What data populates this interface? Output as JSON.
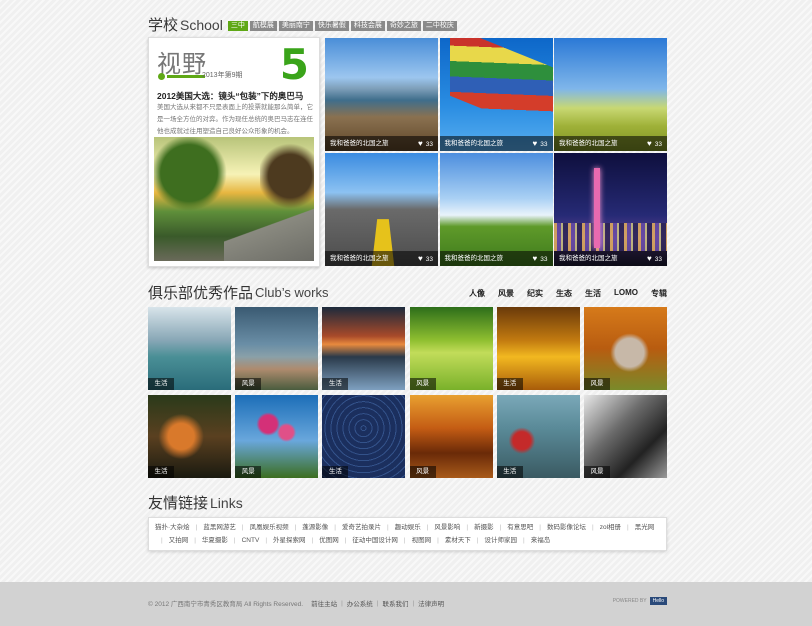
{
  "school": {
    "title_cn": "学校",
    "title_en": "School",
    "tabs": [
      "三中",
      "航模展",
      "美丽南宁",
      "快乐暑假",
      "科技会展",
      "奇妙之旅",
      "二中校庆"
    ],
    "active_tab": 0
  },
  "magazine": {
    "logo": "视野",
    "issue_number": "5",
    "date": "2013年第9期",
    "headline": "2012美国大选：镜头“包装”下的奥巴马",
    "summary": "美国大选从来都不只是表面上的投票就能那么简单，它是一场全方位的对弈。作为现任总统的奥巴马志在连任他也成就过往用塑造自己良好公众形象的机会。"
  },
  "photo_grid": [
    {
      "caption": "我和爸爸的北国之旅",
      "likes": "33"
    },
    {
      "caption": "我和爸爸的北国之旅",
      "likes": "33"
    },
    {
      "caption": "我和爸爸的北国之旅",
      "likes": "33"
    },
    {
      "caption": "我和爸爸的北国之旅",
      "likes": "33"
    },
    {
      "caption": "我和爸爸的北国之旅",
      "likes": "33"
    },
    {
      "caption": "我和爸爸的北国之旅",
      "likes": "33"
    }
  ],
  "club": {
    "title_cn": "俱乐部优秀作品",
    "title_en": "Club’s works",
    "nav": [
      "人像",
      "风景",
      "纪实",
      "生态",
      "生活",
      "LOMO",
      "专辑"
    ],
    "tiles": [
      "生活",
      "风景",
      "生活",
      "风景",
      "生活",
      "风景",
      "生活",
      "风景",
      "生活",
      "风景",
      "生活",
      "风景"
    ]
  },
  "links": {
    "title_cn": "友情链接",
    "title_en": "Links",
    "items": [
      "猫扑·大杂烩",
      "蓝黑网游艺",
      "凤凰娱乐视频",
      "蓬源影像",
      "爱奇艺拍录片",
      "趣动娱乐",
      "风景影响",
      "新摄影",
      "有意思吧",
      "数码影像论坛",
      "zol相册",
      "黑光网",
      "又拍网",
      "华夏摄影",
      "CNTV",
      "外星探索网",
      "优图网",
      "征动中国设计网",
      "视图网",
      "素材天下",
      "设计师家园",
      "来福岛"
    ]
  },
  "footer": {
    "copyright": "© 2012 广西南宁市青秀区教育局  All Rights Reserved.",
    "links": [
      "前往主站",
      "办公系统",
      "联系我们",
      "法律声明"
    ],
    "powered_text": "POWERED BY",
    "powered_badge": "Hello"
  }
}
